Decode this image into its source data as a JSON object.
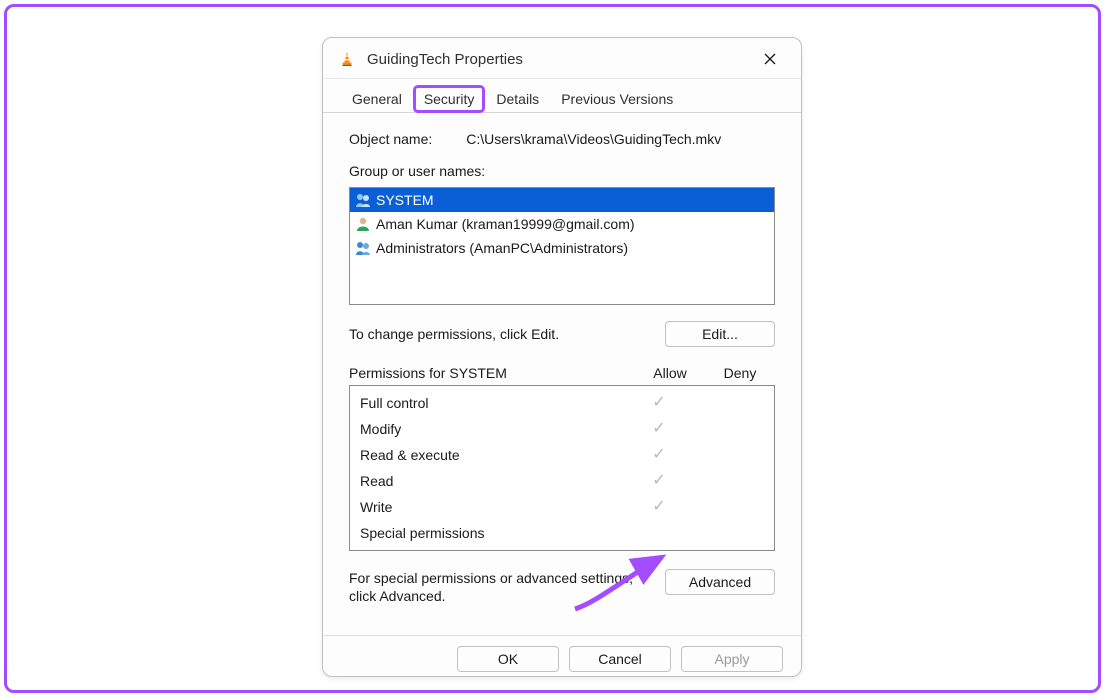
{
  "titlebar": {
    "title": "GuidingTech Properties"
  },
  "tabs": {
    "general": "General",
    "security": "Security",
    "details": "Details",
    "previous": "Previous Versions"
  },
  "object": {
    "label": "Object name:",
    "value": "C:\\Users\\krama\\Videos\\GuidingTech.mkv"
  },
  "group_label": "Group or user names:",
  "users": [
    {
      "name": "SYSTEM",
      "icon": "group",
      "selected": true
    },
    {
      "name": "Aman Kumar (kraman19999@gmail.com)",
      "icon": "user",
      "selected": false
    },
    {
      "name": "Administrators (AmanPC\\Administrators)",
      "icon": "group",
      "selected": false
    }
  ],
  "edit": {
    "text": "To change permissions, click Edit.",
    "button": "Edit..."
  },
  "perm_header": {
    "title": "Permissions for SYSTEM",
    "allow": "Allow",
    "deny": "Deny"
  },
  "permissions": [
    {
      "name": "Full control",
      "allow": true,
      "deny": false
    },
    {
      "name": "Modify",
      "allow": true,
      "deny": false
    },
    {
      "name": "Read & execute",
      "allow": true,
      "deny": false
    },
    {
      "name": "Read",
      "allow": true,
      "deny": false
    },
    {
      "name": "Write",
      "allow": true,
      "deny": false
    },
    {
      "name": "Special permissions",
      "allow": false,
      "deny": false
    }
  ],
  "advanced": {
    "text": "For special permissions or advanced settings, click Advanced.",
    "button": "Advanced"
  },
  "footer": {
    "ok": "OK",
    "cancel": "Cancel",
    "apply": "Apply"
  }
}
